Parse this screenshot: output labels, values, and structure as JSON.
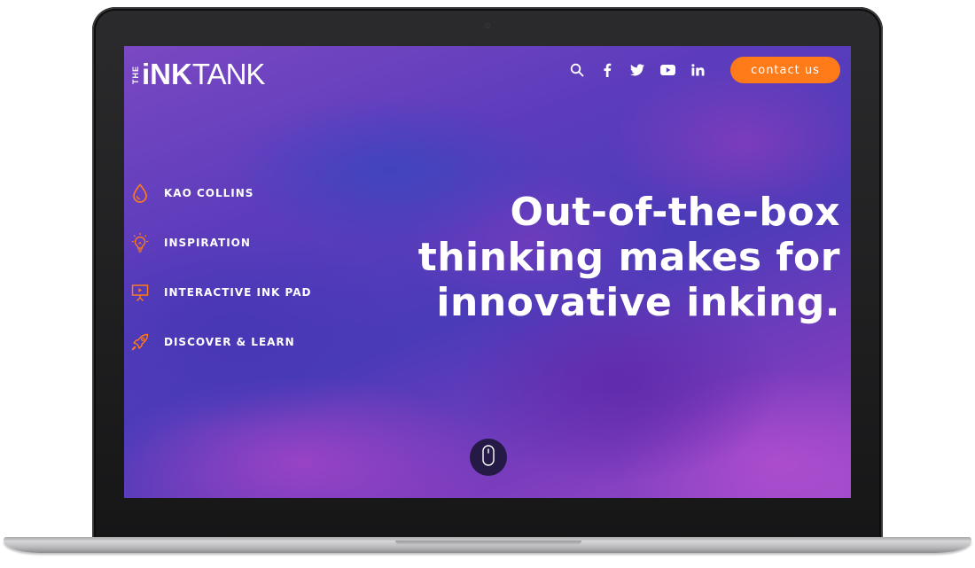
{
  "logo": {
    "the": "THE",
    "ink": "iNK",
    "tank": "TANK"
  },
  "header": {
    "icons": [
      "search-icon",
      "facebook-icon",
      "twitter-icon",
      "youtube-icon",
      "linkedin-icon"
    ],
    "contact_label": "contact us"
  },
  "sidenav": {
    "items": [
      {
        "label": "KAO COLLINS",
        "icon": "ink-drop-icon"
      },
      {
        "label": "INSPIRATION",
        "icon": "lightbulb-icon"
      },
      {
        "label": "INTERACTIVE INK PAD",
        "icon": "presentation-board-icon"
      },
      {
        "label": "DISCOVER & LEARN",
        "icon": "rocket-icon"
      }
    ]
  },
  "hero": {
    "line1": "Out-of-the-box",
    "line2": "thinking makes for",
    "line3": "innovative inking."
  },
  "colors": {
    "accent": "#ff7a18",
    "text": "#ffffff",
    "scroll_bg": "#241a45"
  },
  "scroll_indicator": {
    "icon": "mouse-icon"
  }
}
